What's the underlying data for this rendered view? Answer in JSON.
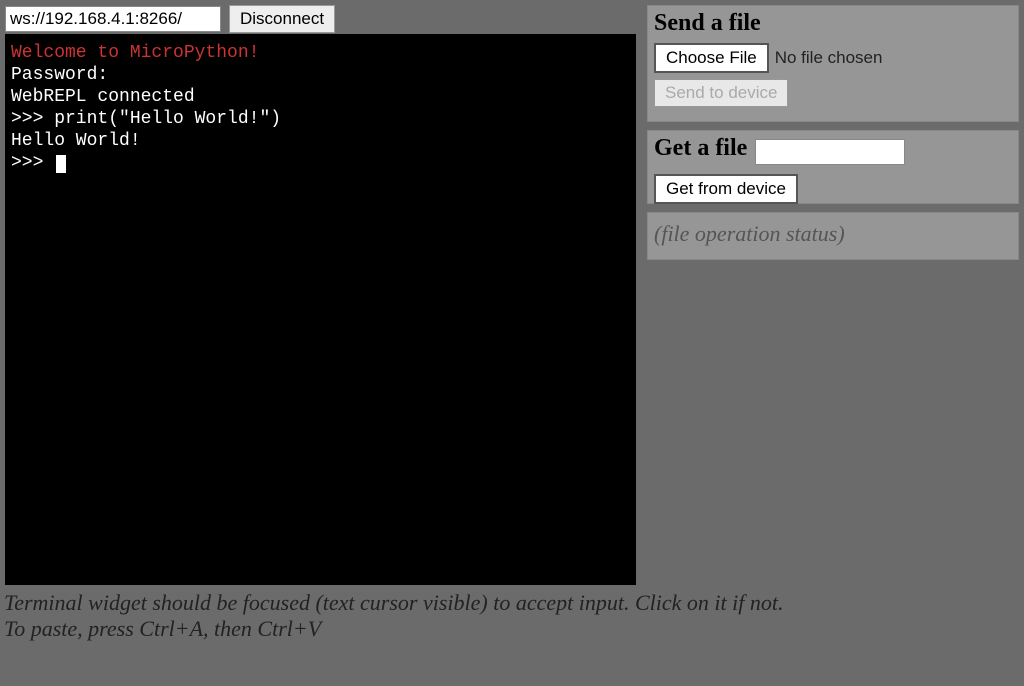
{
  "connection": {
    "ws_url": "ws://192.168.4.1:8266/",
    "disconnect_label": "Disconnect"
  },
  "terminal": {
    "welcome": "Welcome to MicroPython!",
    "lines": [
      "Password:",
      "WebREPL connected",
      ">>> print(\"Hello World!\")",
      "Hello World!",
      ">>> "
    ]
  },
  "send_panel": {
    "title": "Send a file",
    "choose_label": "Choose File",
    "file_status": "No file chosen",
    "send_label": "Send to device"
  },
  "get_panel": {
    "title": "Get a file",
    "filename": "",
    "get_label": "Get from device"
  },
  "status_panel": {
    "placeholder": "(file operation status)"
  },
  "hint": {
    "line1": "Terminal widget should be focused (text cursor visible) to accept input. Click on it if not.",
    "line2": "To paste, press Ctrl+A, then Ctrl+V"
  }
}
